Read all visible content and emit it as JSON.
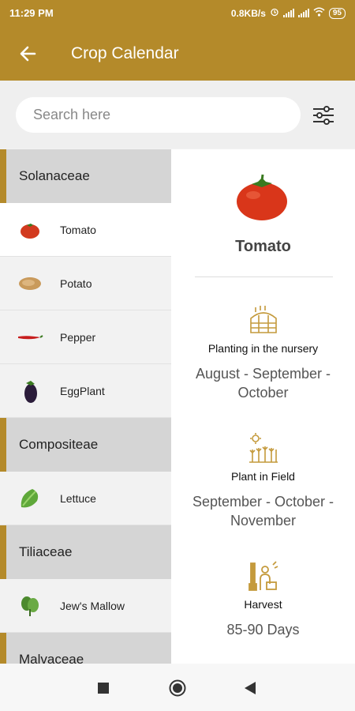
{
  "status_bar": {
    "time": "11:29 PM",
    "network_speed": "0.8KB/s",
    "battery": "95",
    "icons": [
      "alarm-icon",
      "signal-icon",
      "signal-icon",
      "wifi-icon",
      "battery-icon"
    ]
  },
  "app_bar": {
    "title": "Crop Calendar",
    "back_icon": "back-arrow-icon"
  },
  "search": {
    "placeholder": "Search here",
    "filter_icon": "filter-sliders-icon"
  },
  "crop_list": [
    {
      "type": "category",
      "label": "Solanaceae"
    },
    {
      "type": "item",
      "label": "Tomato",
      "icon": "tomato-icon",
      "selected": true
    },
    {
      "type": "item",
      "label": "Potato",
      "icon": "potato-icon"
    },
    {
      "type": "item",
      "label": "Pepper",
      "icon": "pepper-icon"
    },
    {
      "type": "item",
      "label": "EggPlant",
      "icon": "eggplant-icon"
    },
    {
      "type": "category",
      "label": "Compositeae"
    },
    {
      "type": "item",
      "label": "Lettuce",
      "icon": "lettuce-icon"
    },
    {
      "type": "category",
      "label": "Tiliaceae"
    },
    {
      "type": "item",
      "label": "Jew's Mallow",
      "icon": "mallow-icon"
    },
    {
      "type": "category",
      "label": "Malvaceae"
    }
  ],
  "detail": {
    "crop_name": "Tomato",
    "hero_icon": "tomato-icon",
    "sections": [
      {
        "icon": "greenhouse-icon",
        "title": "Planting in the nursery",
        "value": "August - September - October"
      },
      {
        "icon": "field-plant-icon",
        "title": "Plant in Field",
        "value": "September - October - November"
      },
      {
        "icon": "harvest-icon",
        "title": "Harvest",
        "value": "85-90 Days"
      }
    ]
  },
  "nav_bar": {
    "buttons": [
      "recents-square-icon",
      "home-circle-icon",
      "back-triangle-icon"
    ]
  },
  "colors": {
    "brand": "#b48a2a",
    "category_bg": "#d5d5d5",
    "icon_gold": "#c49a3c"
  }
}
